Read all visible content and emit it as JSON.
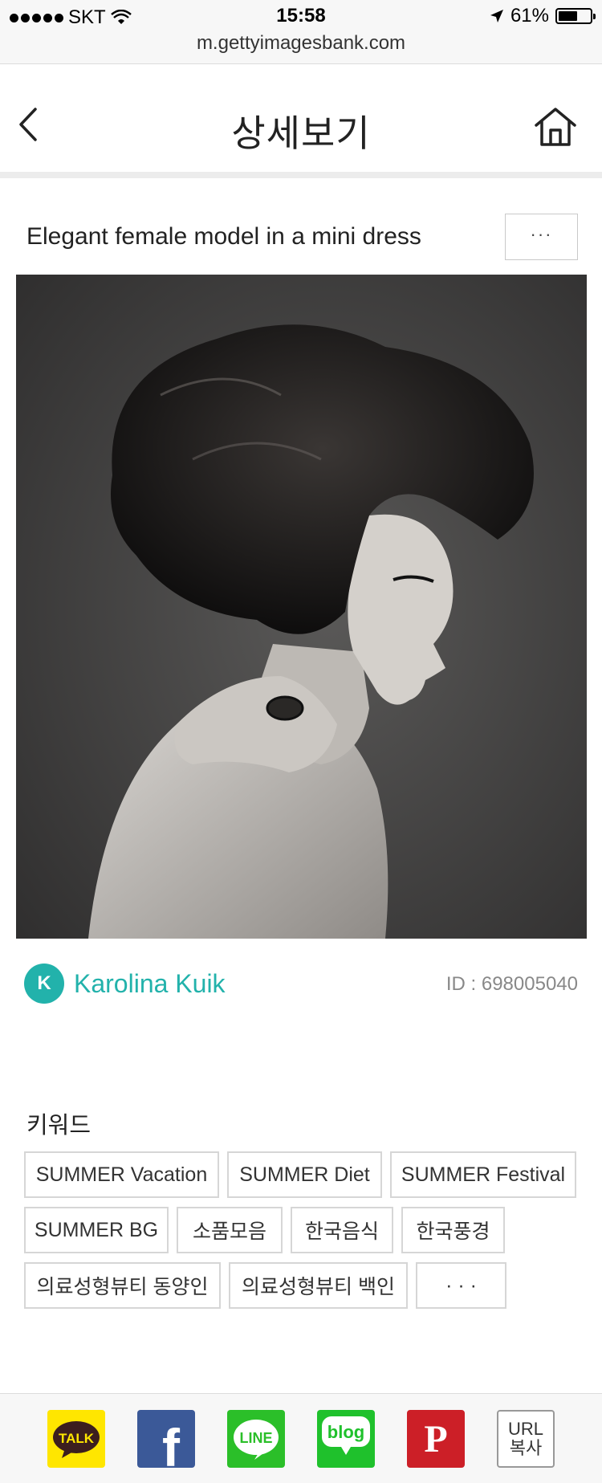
{
  "status_bar": {
    "carrier": "SKT",
    "time": "15:58",
    "battery": "61%",
    "battery_level": 0.61
  },
  "browser": {
    "url": "m.gettyimagesbank.com"
  },
  "header": {
    "title": "상세보기",
    "back_icon": "chevron-left-icon",
    "home_icon": "home-icon"
  },
  "photo": {
    "title": "Elegant female model in a mini dress",
    "more_label": "···",
    "author_initial": "K",
    "author": "Karolina Kuik",
    "id_label": "ID : 698005040"
  },
  "keywords": {
    "heading": "키워드",
    "tags": [
      "SUMMER Vacation",
      "SUMMER Diet",
      "SUMMER Festival",
      "SUMMER BG",
      "소품모음",
      "한국음식",
      "한국풍경",
      "의료성형뷰티 동양인",
      "의료성형뷰티 백인",
      "· · ·"
    ]
  },
  "share": {
    "talk": "TALK",
    "facebook": "f",
    "line": "LINE",
    "blog": "blog",
    "pinterest": "P",
    "url_line1": "URL",
    "url_line2": "복사"
  },
  "colors": {
    "accent": "#22b2ab",
    "kakao": "#ffe600",
    "facebook": "#3b5998",
    "line": "#2bbf29",
    "blog": "#1fc12c",
    "pinterest": "#cc1f27"
  }
}
